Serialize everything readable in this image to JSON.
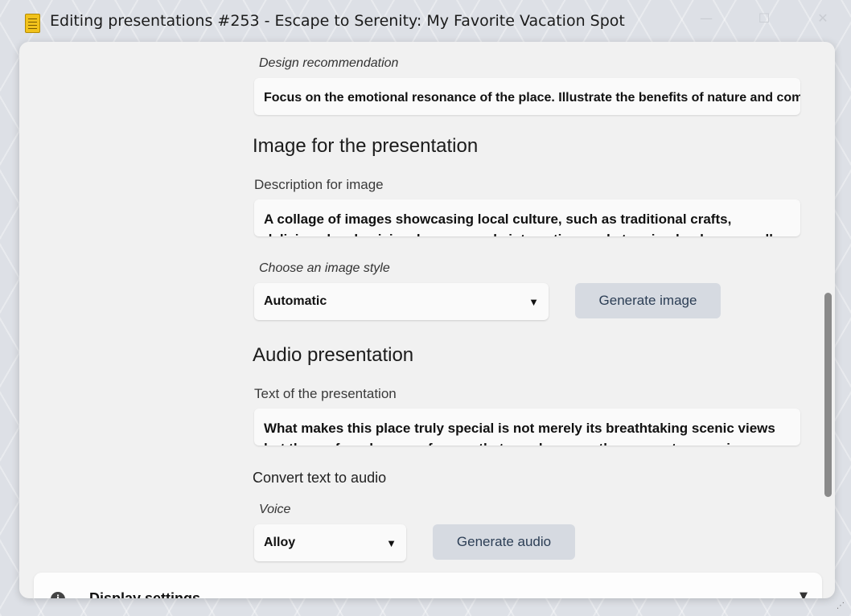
{
  "window": {
    "title": "Editing presentations #253 - Escape to Serenity: My Favorite Vacation Spot",
    "app_icon": "notepad-icon",
    "controls": {
      "minimize": "—",
      "maximize": "☐",
      "close": "✕"
    }
  },
  "design": {
    "label": "Design recommendation",
    "value": "Focus on the emotional resonance of the place. Illustrate the benefits of nature and community"
  },
  "image_section": {
    "title": "Image for the presentation",
    "description_label": "Description for image",
    "description_value": "A collage of images showcasing local culture, such as traditional crafts, delicious local cuisine, happy people interacting, and stunning landscapes, all",
    "style_label": "Choose an image style",
    "style_selected": "Automatic",
    "generate_label": "Generate image"
  },
  "audio_section": {
    "title": "Audio presentation",
    "text_label": "Text of the presentation",
    "text_value": "What makes this place truly special is not merely its breathtaking scenic views but the profound sense of peace that envelops you the moment you arrive",
    "convert_label": "Convert text to audio",
    "voice_label": "Voice",
    "voice_selected": "Alloy",
    "generate_label": "Generate audio"
  },
  "display_settings": {
    "label": "Display settings",
    "icon": "info-icon"
  },
  "dropdown_arrow": "▼",
  "collapse_arrow": "▼",
  "colors": {
    "button_bg": "#d6dae1",
    "button_text": "#2c3e55",
    "dialog_bg": "#f1f1f1"
  }
}
